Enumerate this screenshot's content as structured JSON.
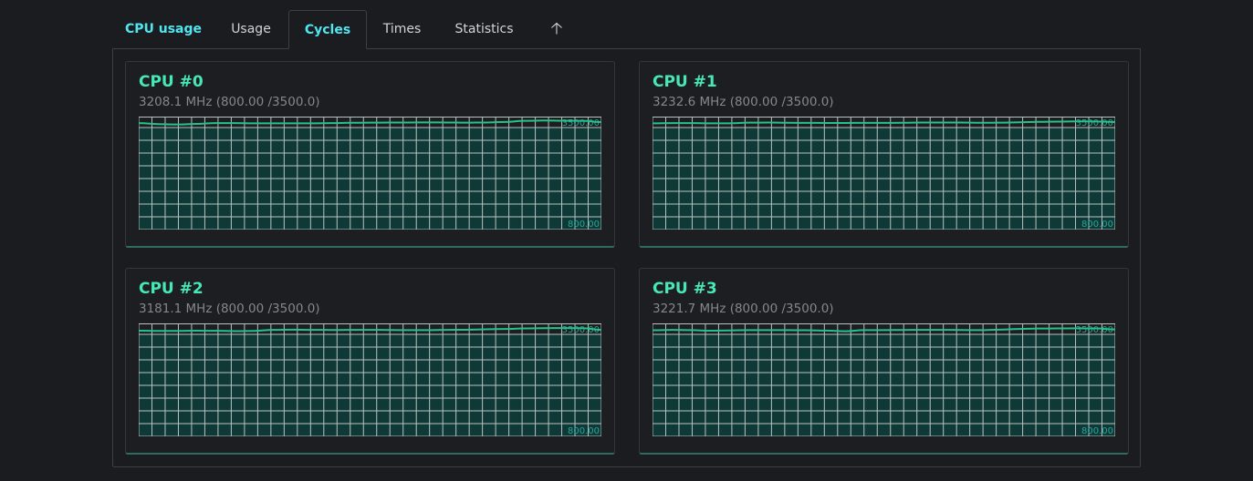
{
  "tabs": [
    {
      "label": "CPU usage",
      "state": "brand"
    },
    {
      "label": "Usage",
      "state": "normal"
    },
    {
      "label": "Cycles",
      "state": "active"
    },
    {
      "label": "Times",
      "state": "normal"
    },
    {
      "label": "Statistics",
      "state": "normal"
    },
    {
      "label": "",
      "icon": "arrow-up-icon",
      "state": "normal"
    }
  ],
  "cpus": [
    {
      "title": "CPU #0",
      "subtitle": "3208.1 MHz (800.00 /3500.0)",
      "max_label": "3500.00",
      "min_label": "800.00",
      "series": [
        3385,
        3360,
        3350,
        3365,
        3385,
        3385,
        3380,
        3378,
        3378,
        3380,
        3385,
        3392,
        3395,
        3398,
        3400,
        3402,
        3400,
        3395,
        3400,
        3412,
        3440,
        3450,
        3445,
        3440,
        3410
      ]
    },
    {
      "title": "CPU #1",
      "subtitle": "3232.6 MHz (800.00 /3500.0)",
      "max_label": "3500.00",
      "min_label": "800.00",
      "series": [
        3380,
        3385,
        3385,
        3380,
        3380,
        3395,
        3398,
        3392,
        3390,
        3388,
        3388,
        3390,
        3390,
        3392,
        3398,
        3400,
        3398,
        3392,
        3395,
        3405,
        3415,
        3420,
        3428,
        3425,
        3412
      ]
    },
    {
      "title": "CPU #2",
      "subtitle": "3181.1 MHz (800.00 /3500.0)",
      "max_label": "3500.00",
      "min_label": "800.00",
      "series": [
        3365,
        3358,
        3360,
        3365,
        3362,
        3355,
        3360,
        3385,
        3390,
        3385,
        3382,
        3384,
        3385,
        3382,
        3378,
        3380,
        3385,
        3388,
        3398,
        3408,
        3420,
        3428,
        3430,
        3428,
        3385
      ]
    },
    {
      "title": "CPU #3",
      "subtitle": "3221.7 MHz (800.00 /3500.0)",
      "max_label": "3500.00",
      "min_label": "800.00",
      "series": [
        3375,
        3385,
        3378,
        3365,
        3372,
        3378,
        3380,
        3378,
        3375,
        3368,
        3352,
        3378,
        3380,
        3382,
        3385,
        3385,
        3382,
        3378,
        3390,
        3408,
        3418,
        3420,
        3425,
        3420,
        3395
      ]
    }
  ],
  "graph": {
    "ymin": 800,
    "ymax": 3500,
    "grid_cols": 35,
    "grid_rows": 8,
    "line_color": "#23c48a",
    "grid_color": "#b8c3c0",
    "bg_color": "#0f3936",
    "label_color": "#2aa59b"
  }
}
